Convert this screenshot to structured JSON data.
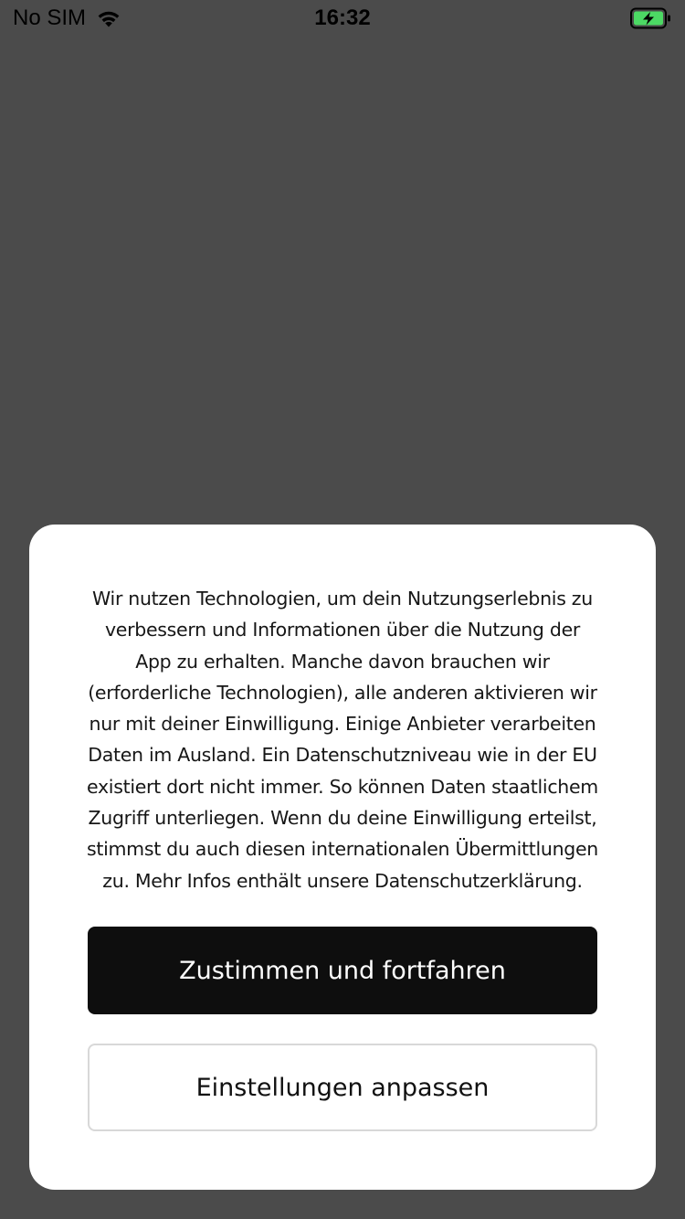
{
  "status_bar": {
    "carrier": "No SIM",
    "time": "16:32",
    "icons": [
      "wifi-icon",
      "battery-charging-icon"
    ],
    "battery_color": "#4cd964"
  },
  "consent_dialog": {
    "body_text": "Wir nutzen Technologien, um dein Nutzungserlebnis zu verbessern und Informationen über die Nutzung der App zu erhalten. Manche davon brauchen wir (erforderliche Technologien), alle anderen aktivieren wir nur mit deiner Einwilligung. Einige Anbieter verarbeiten Daten im Ausland. Ein Datenschutzniveau wie in der EU existiert dort nicht immer. So können Daten staatlichem Zugriff unterliegen. Wenn du deine Einwilligung erteilst, stimmst du auch diesen internationalen Übermittlungen zu. Mehr Infos enthält unsere Datenschutzerklärung.",
    "accept_label": "Zustimmen und fortfahren",
    "settings_label": "Einstellungen anpassen"
  },
  "colors": {
    "backdrop": "#4b4b4b",
    "dialog": "#ffffff",
    "primary_button": "#0e0e0e",
    "secondary_border": "#d8d8d8"
  }
}
